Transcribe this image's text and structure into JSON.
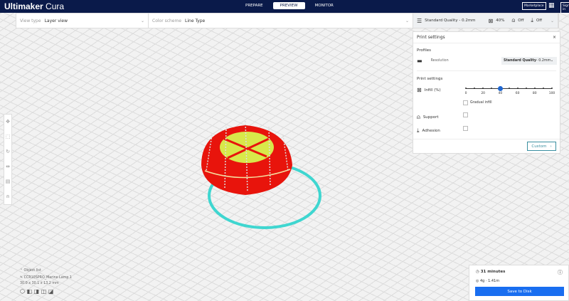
{
  "app": {
    "name_bold": "Ultimaker",
    "name_light": "Cura"
  },
  "stages": [
    {
      "label": "PREPARE"
    },
    {
      "label": "PREVIEW",
      "active": true
    },
    {
      "label": "MONITOR"
    }
  ],
  "header": {
    "marketplace": "Marketplace",
    "sign_in": "Sign in"
  },
  "toolbar": {
    "view_type_label": "View type",
    "view_type_value": "Layer view",
    "color_scheme_label": "Color scheme",
    "color_scheme_value": "Line Type",
    "quality": "Standard Quality - 0.2mm",
    "infill": "40%",
    "support": "Off",
    "adhesion": "Off"
  },
  "print_settings": {
    "title": "Print settings",
    "profiles_heading": "Profiles",
    "resolution_label": "Resolution",
    "resolution_bold": "Standard Quality",
    "resolution_rest": " - 0.2mm",
    "section_heading": "Print settings",
    "infill_label": "Infill (%)",
    "infill_value": 40,
    "slider_labels": [
      "0",
      "20",
      "40",
      "60",
      "80",
      "100"
    ],
    "gradual_infill": "Gradual infill",
    "support_label": "Support",
    "adhesion_label": "Adhesion",
    "custom_button": "Custom"
  },
  "object": {
    "list_label": "Object list",
    "name": "CCR10SPRO_Marine Lamp 1",
    "dimensions": "30.0 x 30.1 x 13.2 mm"
  },
  "estimate": {
    "time": "31 minutes",
    "material": "4g · 1.41m",
    "save_button": "Save to Disk"
  },
  "colors": {
    "header": "#0a1a4a",
    "accent": "#196ef0",
    "model": "#e8140c",
    "skirt": "#3fd6d0",
    "infill": "#d8e84a"
  }
}
